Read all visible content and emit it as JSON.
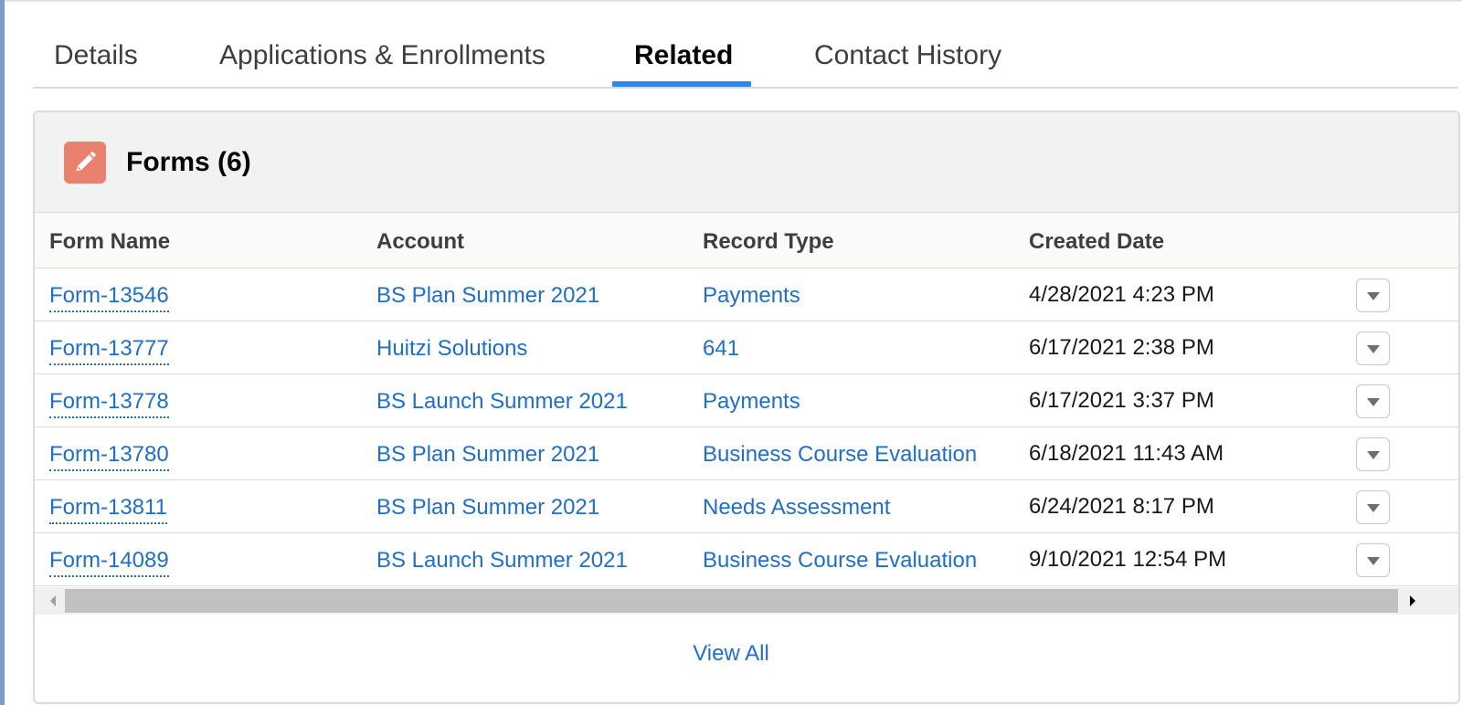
{
  "tabs": [
    {
      "label": "Details"
    },
    {
      "label": "Applications & Enrollments"
    },
    {
      "label": "Related"
    },
    {
      "label": "Contact History"
    }
  ],
  "active_tab": "Related",
  "card": {
    "title": "Forms (6)",
    "icon": "edit-pencil-icon",
    "icon_color": "#e8826f",
    "view_all": "View All"
  },
  "table": {
    "headers": [
      "Form Name",
      "Account",
      "Record Type",
      "Created Date"
    ],
    "rows": [
      {
        "form_name": "Form-13546",
        "account": "BS Plan Summer 2021",
        "record_type": "Payments",
        "created_date": "4/28/2021 4:23 PM"
      },
      {
        "form_name": "Form-13777",
        "account": "Huitzi Solutions",
        "record_type": "641",
        "created_date": "6/17/2021 2:38 PM"
      },
      {
        "form_name": "Form-13778",
        "account": "BS Launch Summer 2021",
        "record_type": "Payments",
        "created_date": "6/17/2021 3:37 PM"
      },
      {
        "form_name": "Form-13780",
        "account": "BS Plan Summer 2021",
        "record_type": "Business Course Evaluation",
        "created_date": "6/18/2021 11:43 AM"
      },
      {
        "form_name": "Form-13811",
        "account": "BS Plan Summer 2021",
        "record_type": "Needs Assessment",
        "created_date": "6/24/2021 8:17 PM"
      },
      {
        "form_name": "Form-14089",
        "account": "BS Launch Summer 2021",
        "record_type": "Business Course Evaluation",
        "created_date": "9/10/2021 12:54 PM"
      }
    ]
  },
  "colors": {
    "link": "#1f6fc9",
    "active_tab_underline": "#2f86ea"
  }
}
